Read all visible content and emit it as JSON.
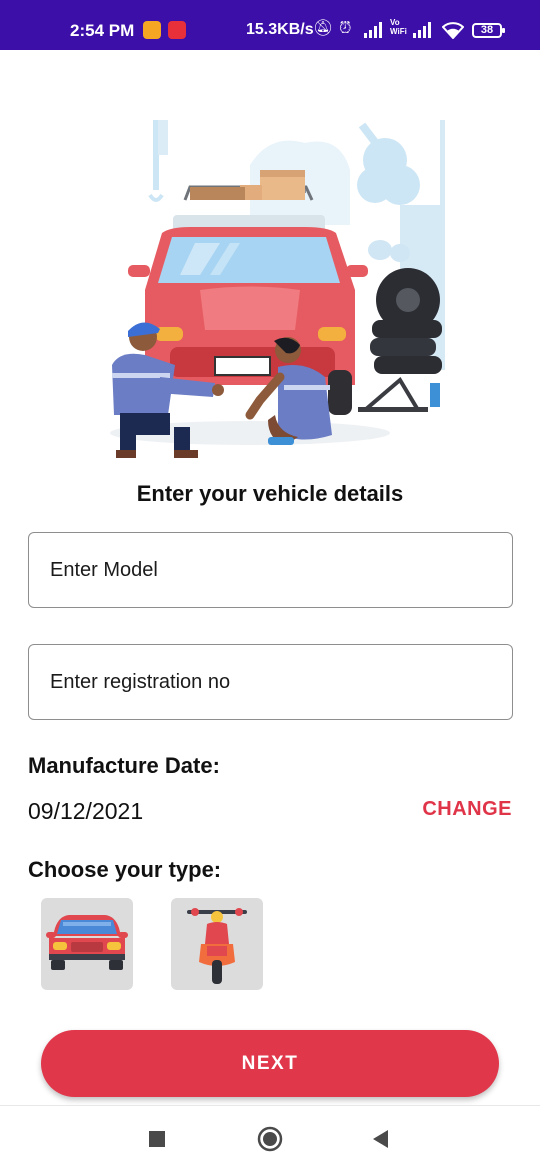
{
  "status_bar": {
    "time": "2:54 PM",
    "network_speed": "15.3KB/s",
    "battery_level": "38",
    "icons": [
      "notes-app-icon",
      "wps-app-icon",
      "mute-icon",
      "alarm-icon",
      "signal-icon",
      "vowifi-icon",
      "signal-icon",
      "wifi-icon",
      "battery-icon"
    ],
    "vowifi_label": "Vo WiFi"
  },
  "hero": {
    "icon": "mechanics-repairing-car-illustration"
  },
  "form": {
    "title": "Enter your vehicle details",
    "model_placeholder": "Enter Model",
    "registration_placeholder": "Enter registration no"
  },
  "manufacture": {
    "label": "Manufacture Date:",
    "date": "09/12/2021",
    "change_label": "CHANGE"
  },
  "vehicle_type": {
    "label": "Choose your type:",
    "options": [
      {
        "icon": "car-icon"
      },
      {
        "icon": "scooter-icon"
      }
    ]
  },
  "next_label": "NEXT",
  "colors": {
    "status_bar": "#3c0fa8",
    "accent": "#e0374a",
    "option_bg": "#dcdcdc"
  },
  "nav_bar": {
    "icons": [
      "recents-icon",
      "home-icon",
      "back-icon"
    ]
  }
}
